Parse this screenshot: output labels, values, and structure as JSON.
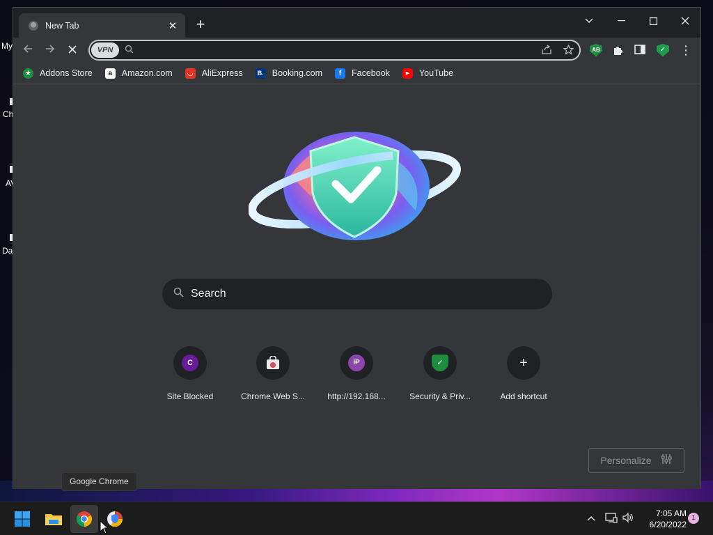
{
  "desktop": {
    "icon_labels": [
      "My",
      "Ch",
      "AV",
      "Da"
    ]
  },
  "browser": {
    "tab": {
      "title": "New Tab",
      "close": "✕"
    },
    "new_tab": "+",
    "window_controls": {
      "dropdown": "⌄",
      "minimize": "—",
      "maximize": "☐",
      "close": "✕"
    },
    "toolbar": {
      "back": "←",
      "forward": "→",
      "stop": "✕",
      "vpn_label": "VPN",
      "address_value": "",
      "search_glyph": "⚲"
    },
    "extensions": {
      "ab_label": "AB",
      "menu": "⋮"
    },
    "bookmarks": [
      {
        "label": "Addons Store",
        "icon": "addons-store-icon",
        "color": "#1e8e3e",
        "glyph": "★"
      },
      {
        "label": "Amazon.com",
        "icon": "amazon-icon",
        "color": "#ffffff",
        "glyph": "a"
      },
      {
        "label": "AliExpress",
        "icon": "aliexpress-icon",
        "color": "#e43225",
        "glyph": "◡"
      },
      {
        "label": "Booking.com",
        "icon": "booking-icon",
        "color": "#003580",
        "glyph": "B."
      },
      {
        "label": "Facebook",
        "icon": "facebook-icon",
        "color": "#1877f2",
        "glyph": "f"
      },
      {
        "label": "YouTube",
        "icon": "youtube-icon",
        "color": "#ff0000",
        "glyph": "▶"
      }
    ]
  },
  "ntp": {
    "search_placeholder": "Search",
    "shortcuts": [
      {
        "label": "Site Blocked",
        "glyph": "C",
        "color": "#6a1b9a"
      },
      {
        "label": "Chrome Web S...",
        "glyph": "🛍",
        "color": "#202124"
      },
      {
        "label": "http://192.168...",
        "glyph": "IP",
        "color": "#8e44ad"
      },
      {
        "label": "Security & Priv...",
        "glyph": "✓",
        "color": "#1e8e3e"
      },
      {
        "label": "Add shortcut",
        "glyph": "+",
        "color": "#202124"
      }
    ],
    "personalize_label": "Personalize"
  },
  "tooltip": "Google Chrome",
  "taskbar": {
    "time": "7:05 AM",
    "date": "6/20/2022",
    "notification_count": "1",
    "tray": {
      "chevron": "^",
      "network": "🖵",
      "volume": "🔊"
    }
  }
}
